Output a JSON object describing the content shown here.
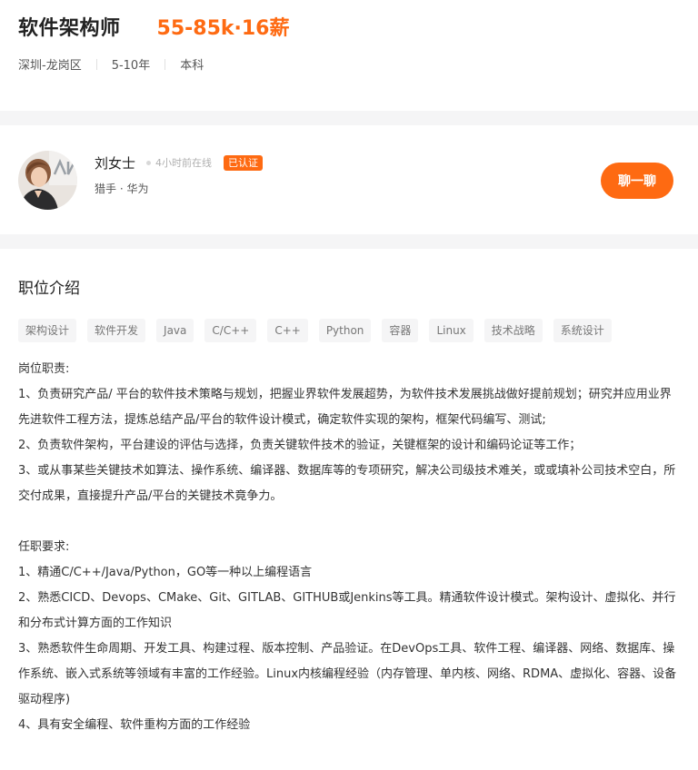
{
  "job": {
    "title": "软件架构师",
    "salary": "55-85k·16薪",
    "location": "深圳-龙岗区",
    "experience": "5-10年",
    "education": "本科"
  },
  "recruiter": {
    "name": "刘女士",
    "online_status": "4小时前在线",
    "verified_badge": "已认证",
    "role_company": "猎手 · 华为",
    "chat_button": "聊一聊"
  },
  "section": {
    "title": "职位介绍",
    "tags": [
      "架构设计",
      "软件开发",
      "Java",
      "C/C++",
      "C++",
      "Python",
      "容器",
      "Linux",
      "技术战略",
      "系统设计"
    ]
  },
  "description": {
    "duties_heading": "岗位职责:",
    "duties": [
      "1、负责研究产品/ 平台的软件技术策略与规划，把握业界软件发展超势，为软件技术发展挑战做好提前规划；研究并应用业界先进软件工程方法，提炼总结产品/平台的软件设计模式，确定软件实现的架构，框架代码编写、测试;",
      "2、负责软件架构，平台建设的评估与选择，负责关键软件技术的验证，关键框架的设计和编码论证等工作；",
      "3、或从事某些关键技术如算法、操作系统、编译器、数据库等的专项研究，解决公司级技术难关，或或填补公司技术空白，所交付成果，直接提升产品/平台的关键技术竟争力。"
    ],
    "requirements_heading": "任职要求:",
    "requirements": [
      "1、精通C/C++/Java/Python，GO等一种以上编程语言",
      "2、熟悉CICD、Devops、CMake、Git、GITLAB、GITHUB或Jenkins等工具。精通软件设计模式。架构设计、虚拟化、并行和分布式计算方面的工作知识",
      "3、熟悉软件生命周期、开发工具、构建过程、版本控制、产品验证。在DevOps工具、软件工程、编译器、网络、数据库、操作系统、嵌入式系统等领域有丰富的工作经验。Linux内核编程经验（内存管理、单内核、网络、RDMA、虚拟化、容器、设备驱动程序)",
      "4、具有安全编程、软件重构方面的工作经验"
    ]
  },
  "colors": {
    "accent": "#fe6a12",
    "band": "#f5f5f6",
    "tag_bg": "#f5f5f6"
  }
}
